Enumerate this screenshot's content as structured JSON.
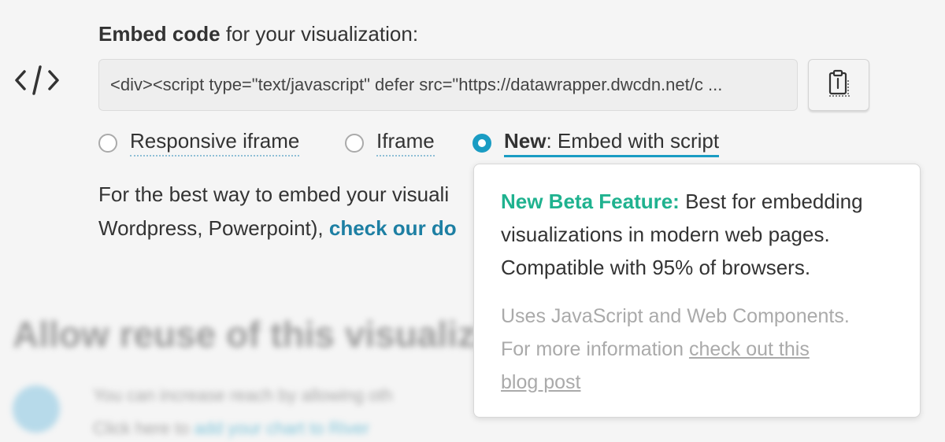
{
  "heading": {
    "bold": "Embed code",
    "rest": " for your visualization:"
  },
  "embed_code": "<div><script type=\"text/javascript\" defer src=\"https://datawrapper.dwcdn.net/c ...",
  "radio_options": [
    {
      "label": "Responsive iframe",
      "selected": false
    },
    {
      "label": "Iframe",
      "selected": false
    },
    {
      "label_bold": "New",
      "label_rest": ": Embed with script",
      "selected": true
    }
  ],
  "info": {
    "line1": "For the best way to embed your visuali",
    "line2_text": "Wordpress, Powerpoint), ",
    "link_text": "check our do"
  },
  "blurred": {
    "heading": "Allow reuse of this visualiza",
    "line1": "You can increase reach by allowing oth",
    "line2_text": "Click here to ",
    "line2_link": "add your chart to River"
  },
  "tooltip": {
    "highlight": "New Beta Feature:",
    "main_line1_rest": " Best for embedding",
    "main_line2": "visualizations in modern web pages.",
    "main_line3": "Compatible with 95% of browsers.",
    "sub_line1": "Uses JavaScript and Web Components.",
    "sub_line2_text": "For more information ",
    "sub_link_part1": "check out this",
    "sub_link_part2": "blog post"
  },
  "colors": {
    "accent": "#1a9cc3",
    "link": "#1d7fa3",
    "beta": "#1fb28f"
  },
  "icons": {
    "embed": "code-icon",
    "copy": "clipboard-icon"
  }
}
